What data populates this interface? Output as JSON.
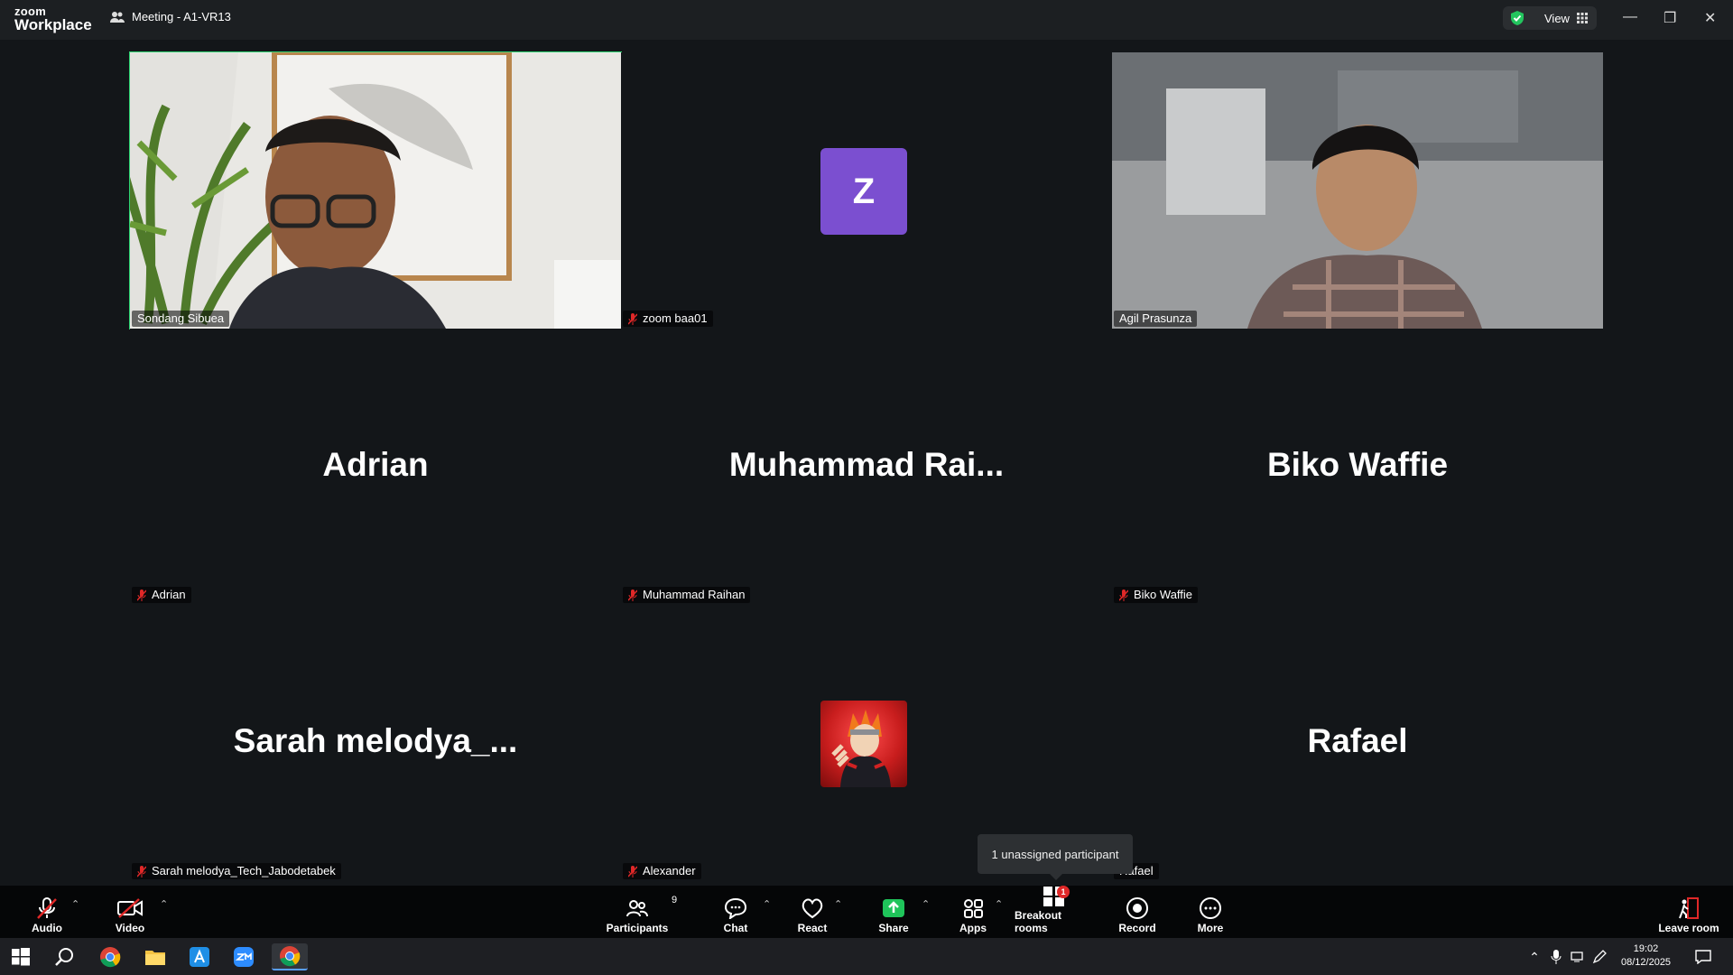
{
  "app": {
    "logo_line1": "zoom",
    "logo_line2": "Workplace",
    "meeting_title": "Meeting - A1-VR13",
    "view_label": "View"
  },
  "tiles": [
    {
      "name": "Sondang Sibuea",
      "big": ""
    },
    {
      "name": "zoom baa01",
      "big": ""
    },
    {
      "name": "Agil Prasunza",
      "big": ""
    },
    {
      "name": "Adrian",
      "big": "Adrian"
    },
    {
      "name": "Muhammad Raihan",
      "big": "Muhammad  Rai..."
    },
    {
      "name": "Biko Waffie",
      "big": "Biko Waffie"
    },
    {
      "name": "Sarah melodya_Tech_Jabodetabek",
      "big": "Sarah  melodya_..."
    },
    {
      "name": "Alexander",
      "big": ""
    },
    {
      "name": "Rafael",
      "big": "Rafael"
    }
  ],
  "avatar_letter": "Z",
  "tooltip": "1 unassigned participant",
  "toolbar": {
    "audio": "Audio",
    "video": "Video",
    "participants": "Participants",
    "participants_count": "9",
    "chat": "Chat",
    "react": "React",
    "share": "Share",
    "apps": "Apps",
    "breakout": "Breakout rooms",
    "breakout_badge": "1",
    "record": "Record",
    "more": "More",
    "leave": "Leave room"
  },
  "taskbar": {
    "time": "19:02",
    "date": "08/12/2025"
  },
  "colors": {
    "active_border": "#2ed573",
    "avatar_bg": "#7b4fd0",
    "share_green": "#1fc45a"
  }
}
